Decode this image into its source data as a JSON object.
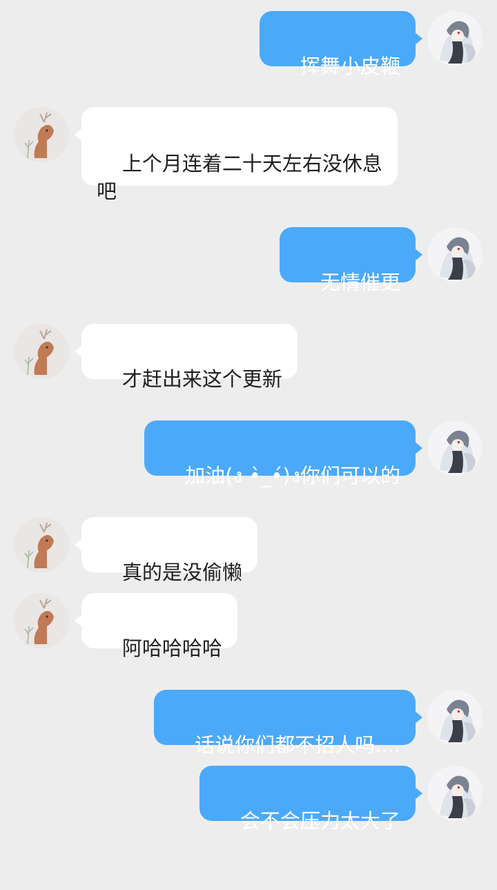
{
  "conversation": {
    "messages": [
      {
        "side": "out",
        "text": "挥舞小皮鞭"
      },
      {
        "side": "in",
        "text": "上个月连着二十天左右没休息\n吧"
      },
      {
        "side": "out",
        "text": "无情催更"
      },
      {
        "side": "in",
        "text": "才赶出来这个更新"
      },
      {
        "side": "out",
        "text": "加油(ง •̀_•́)ง你们可以的"
      },
      {
        "side": "in",
        "text": "真的是没偷懒"
      },
      {
        "side": "in",
        "text": "阿哈哈哈哈"
      },
      {
        "side": "out",
        "text": "话说你们都不招人吗...."
      },
      {
        "side": "out",
        "text": "会不会压力太大了"
      }
    ]
  },
  "avatars": {
    "me": {
      "icon": "anime-girl-avatar-icon",
      "bg": "#f4f4f6"
    },
    "contact": {
      "icon": "deer-avatar-icon",
      "bg": "#e9e6e4"
    }
  },
  "colors": {
    "background": "#ededed",
    "outgoing_bubble": "#4ba9f9",
    "incoming_bubble": "#ffffff"
  }
}
